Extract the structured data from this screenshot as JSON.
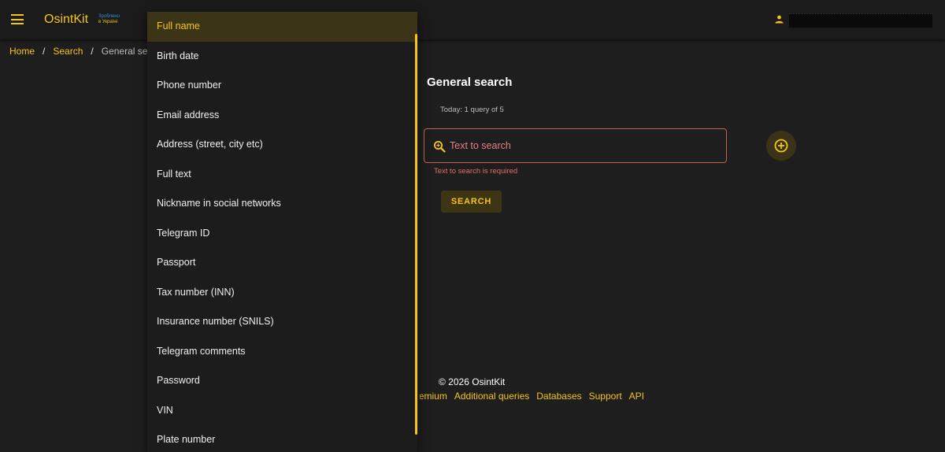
{
  "header": {
    "brand": "OsintKit",
    "made_in_line1": "Зроблено",
    "made_in_line2": "в Україні",
    "user_name": "░░░░░░░░░░░░░░░░░░░░░░░░░░░░░░░░░░░░░░░░"
  },
  "breadcrumb": {
    "home": "Home",
    "search": "Search",
    "current": "General search"
  },
  "main": {
    "title": "General search",
    "quota": "Today: 1 query of 5",
    "search_placeholder": "Text to search",
    "error": "Text to search is required",
    "search_button": "SEARCH"
  },
  "footer": {
    "copyright": "© 2026 OsintKit",
    "links": [
      "Premium",
      "Additional queries",
      "Databases",
      "Support",
      "API"
    ]
  },
  "dropdown": {
    "options": [
      "Full name",
      "Birth date",
      "Phone number",
      "Email address",
      "Address (street, city etc)",
      "Full text",
      "Nickname in social networks",
      "Telegram ID",
      "Passport",
      "Tax number (INN)",
      "Insurance number (SNILS)",
      "Telegram comments",
      "Password",
      "VIN",
      "Plate number"
    ],
    "selected_index": 0
  },
  "colors": {
    "accent": "#f5c518",
    "error": "#e46d6d",
    "background": "#1e1e1e"
  }
}
